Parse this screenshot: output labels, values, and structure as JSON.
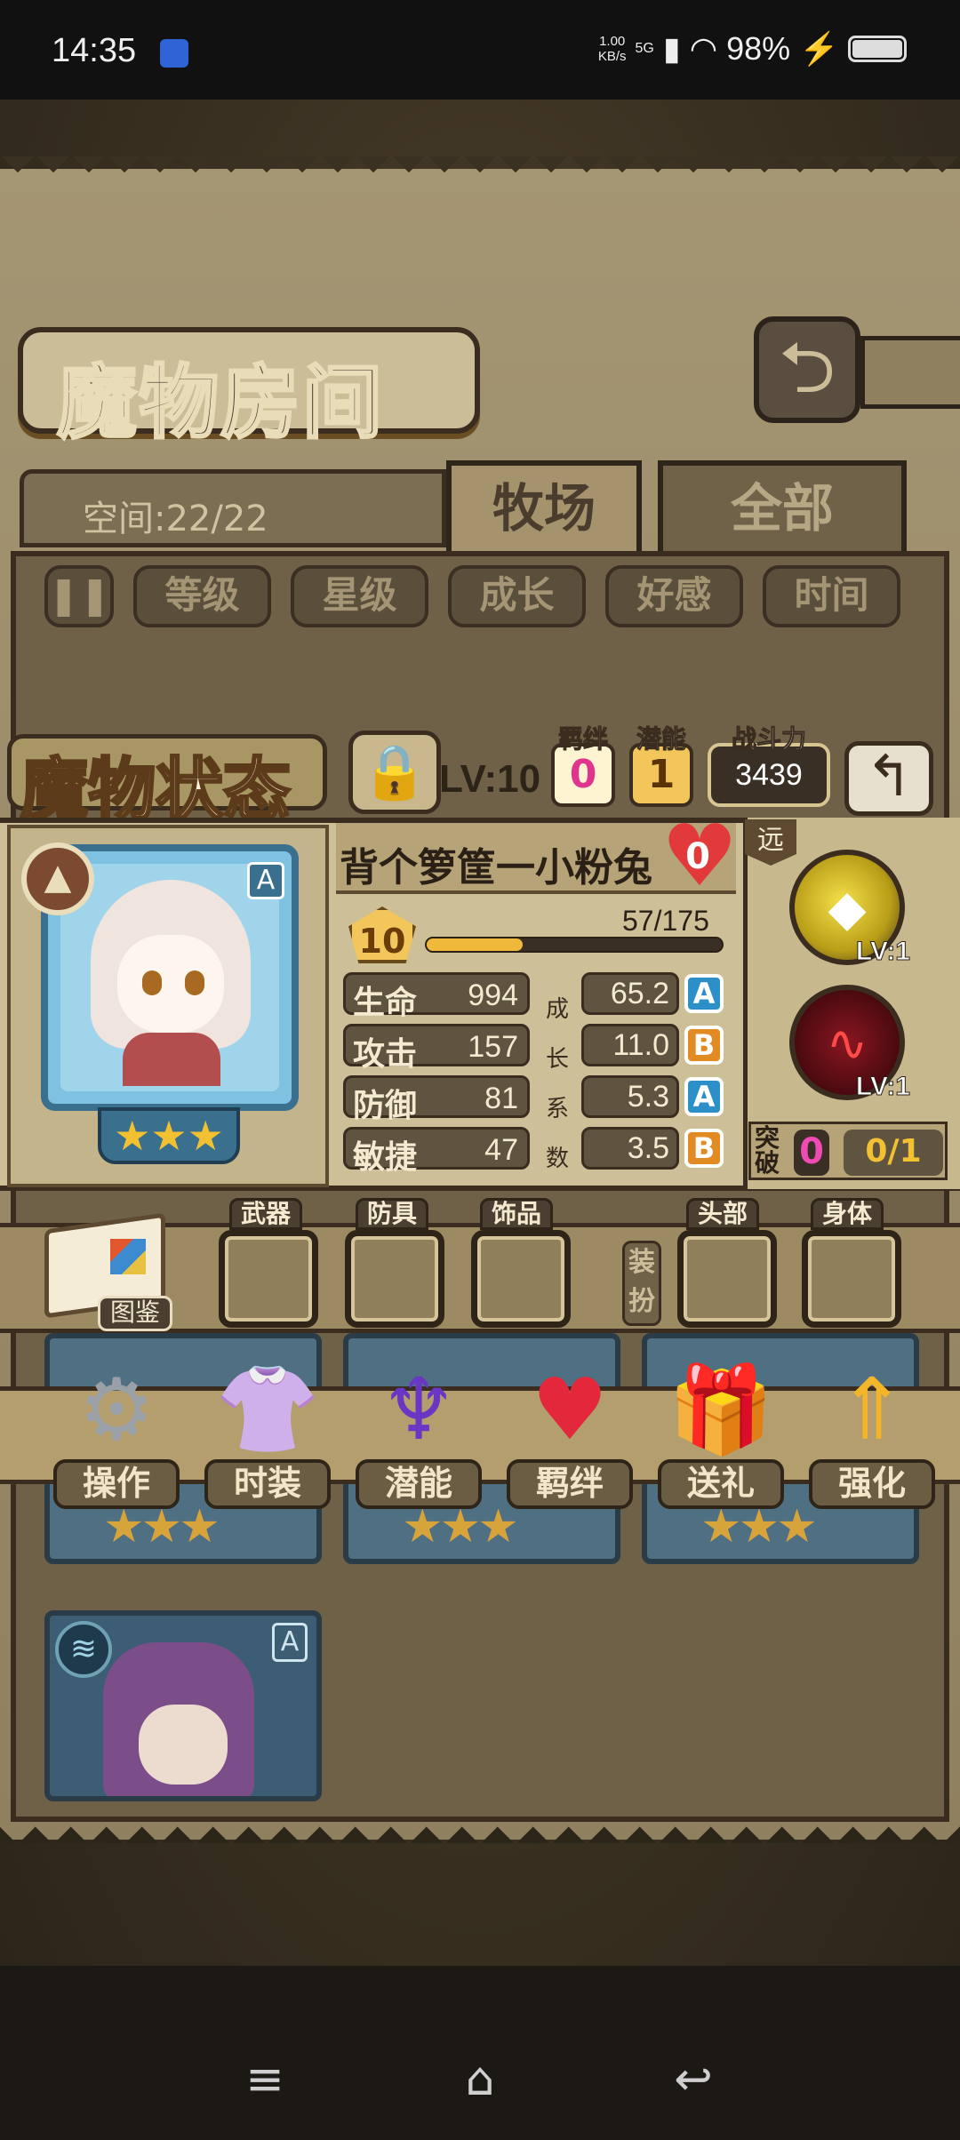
{
  "status_bar": {
    "time": "14:35",
    "speed": "1.00\nKB/s",
    "network": "5G",
    "battery": "98%",
    "icons": [
      "app-notification-icon",
      "signal-icon",
      "wifi-icon",
      "charging-icon",
      "battery-icon"
    ]
  },
  "header": {
    "title": "魔物房间",
    "back_icon": "back-arrow-icon"
  },
  "space": {
    "label": "空间:22/22"
  },
  "tabs": [
    {
      "label": "牧场",
      "active": true
    },
    {
      "label": "全部",
      "active": false
    }
  ],
  "sort_buttons": [
    {
      "label": "",
      "icon": "pause-icon"
    },
    {
      "label": "等级"
    },
    {
      "label": "星级"
    },
    {
      "label": "成长"
    },
    {
      "label": "好感"
    },
    {
      "label": "时间"
    }
  ],
  "monster_status": {
    "title": "魔物状态",
    "level_chip": "LV:10",
    "bond_label": "羁绊",
    "bond_value": "0",
    "potential_label": "潜能",
    "potential_value": "1",
    "power_label": "战斗力",
    "power_value": "3439",
    "name": "背个箩筐一小粉兔",
    "affection": "0",
    "rank": "A",
    "stars": "★★★",
    "level": "10",
    "exp_text": "57/175",
    "exp_fraction": 0.326,
    "growth_label": [
      "成",
      "长",
      "系",
      "数"
    ],
    "stats": [
      {
        "name": "生命",
        "value": "994",
        "growth": "65.2",
        "grade": "A"
      },
      {
        "name": "攻击",
        "value": "157",
        "growth": "11.0",
        "grade": "B"
      },
      {
        "name": "防御",
        "value": "81",
        "growth": "5.3",
        "grade": "A"
      },
      {
        "name": "敏捷",
        "value": "47",
        "growth": "3.5",
        "grade": "B"
      }
    ],
    "range_tag": "远",
    "skills": [
      {
        "lv": "LV:1",
        "icon": "rock-skill-icon"
      },
      {
        "lv": "LV:1",
        "icon": "heartbeat-skill-icon"
      }
    ],
    "breakthrough_label": "突破",
    "breakthrough_value": "0",
    "breakthrough_progress": "0/1"
  },
  "equipment": {
    "book_label": "图鉴",
    "slots": [
      "武器",
      "防具",
      "饰品"
    ],
    "dress_label": "装扮",
    "dress_slots": [
      "头部",
      "身体"
    ]
  },
  "actions": [
    {
      "label": "操作",
      "icon": "gear-icon"
    },
    {
      "label": "时装",
      "icon": "outfit-icon"
    },
    {
      "label": "潜能",
      "icon": "demon-icon"
    },
    {
      "label": "羁绊",
      "icon": "hearts-icon"
    },
    {
      "label": "送礼",
      "icon": "gift-icon"
    },
    {
      "label": "强化",
      "icon": "upgrade-arrows-icon"
    }
  ],
  "monster_cards": [
    {
      "stars": "★★★"
    },
    {
      "stars": "★★★"
    },
    {
      "stars": "★★★"
    },
    {
      "rank": "A",
      "element": "≋"
    }
  ],
  "nav": {
    "menu": "≡",
    "home": "⌂",
    "back": "↩"
  },
  "colors": {
    "parchment": "#9a8b69",
    "dark_frame": "#3a2d1f",
    "grade_a": "#2d8fc8",
    "grade_b": "#e28b23",
    "stars": "#f2c131"
  }
}
